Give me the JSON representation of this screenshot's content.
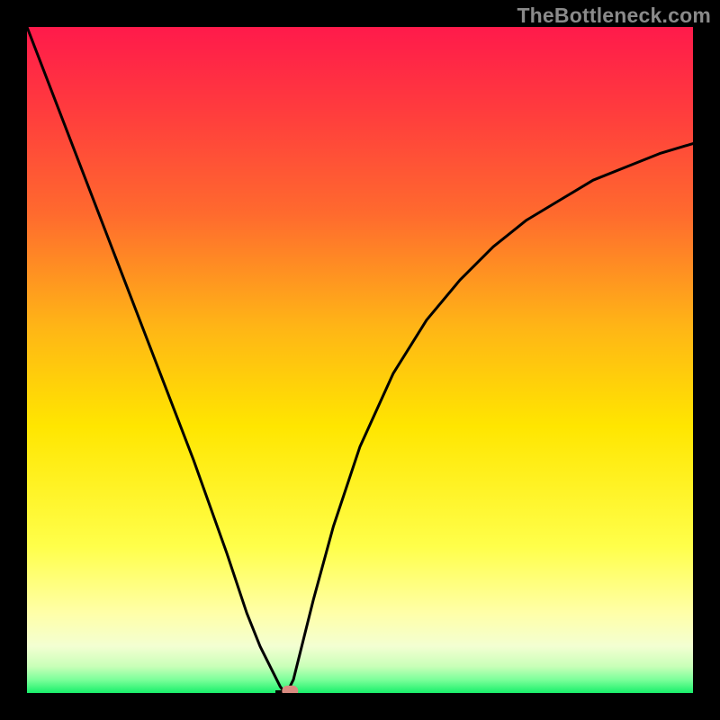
{
  "watermark": "TheBottleneck.com",
  "chart_data": {
    "type": "line",
    "title": "",
    "xlabel": "",
    "ylabel": "",
    "xlim": [
      0,
      100
    ],
    "ylim": [
      0,
      100
    ],
    "grid": false,
    "legend": false,
    "background_gradient": {
      "top_color": "#ff1a4b",
      "mid_colors": [
        "#ff6a2e",
        "#ffb516",
        "#ffe600",
        "#ffff68",
        "#f4ffd0"
      ],
      "bottom_color": "#18f06a"
    },
    "series": [
      {
        "name": "curve-left",
        "x": [
          0,
          5,
          10,
          15,
          20,
          25,
          30,
          33,
          35,
          37,
          38,
          38.5,
          39
        ],
        "y_pct": [
          100,
          87,
          74,
          61,
          48,
          35,
          21,
          12,
          7,
          3,
          1,
          0.3,
          0
        ],
        "color": "#000000"
      },
      {
        "name": "curve-right",
        "x": [
          39,
          40,
          41,
          43,
          46,
          50,
          55,
          60,
          65,
          70,
          75,
          80,
          85,
          90,
          95,
          100
        ],
        "y_pct": [
          0,
          2,
          6,
          14,
          25,
          37,
          48,
          56,
          62,
          67,
          71,
          74,
          77,
          79,
          81,
          82.5
        ],
        "color": "#000000"
      }
    ],
    "marker": {
      "x": 39.5,
      "y_pct": 0.3,
      "color": "#d98a80",
      "shape": "rounded-rect"
    }
  }
}
